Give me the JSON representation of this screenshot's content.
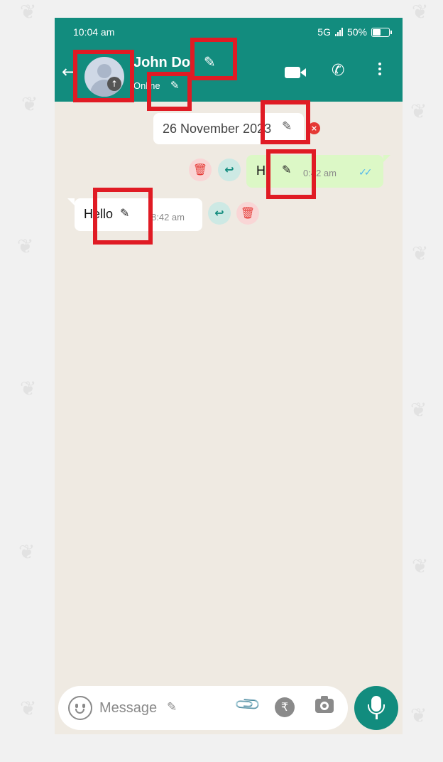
{
  "status_bar": {
    "time": "10:04 am",
    "network": "5G",
    "battery": "50%",
    "battery_level": 0.5
  },
  "header": {
    "back_icon": "arrow-left-icon",
    "contact_name": "John Do",
    "contact_status": "Online",
    "edit_icon": "pencil-icon",
    "actions": [
      "video-call-icon",
      "voice-call-icon",
      "more-options-icon"
    ]
  },
  "chat": {
    "date_chip": "26 November 2023",
    "messages": [
      {
        "direction": "outgoing",
        "text": "Hi",
        "time": "0:42 am",
        "read": true,
        "actions": [
          "delete-icon",
          "reply-icon"
        ]
      },
      {
        "direction": "incoming",
        "text": "Hello",
        "time": "8:42 am",
        "actions": [
          "reply-icon",
          "delete-icon"
        ]
      }
    ]
  },
  "composer": {
    "placeholder": "Message",
    "icons": [
      "emoji-icon",
      "attach-icon",
      "rupee-icon",
      "camera-icon"
    ],
    "send_icon": "microphone-icon"
  },
  "colors": {
    "header": "#128c7e",
    "chat_bg": "#efeae2",
    "outgoing_bubble": "#dcf8c6",
    "incoming_bubble": "#ffffff",
    "highlight": "#e01b24",
    "read_ticks": "#4fb6ec"
  }
}
